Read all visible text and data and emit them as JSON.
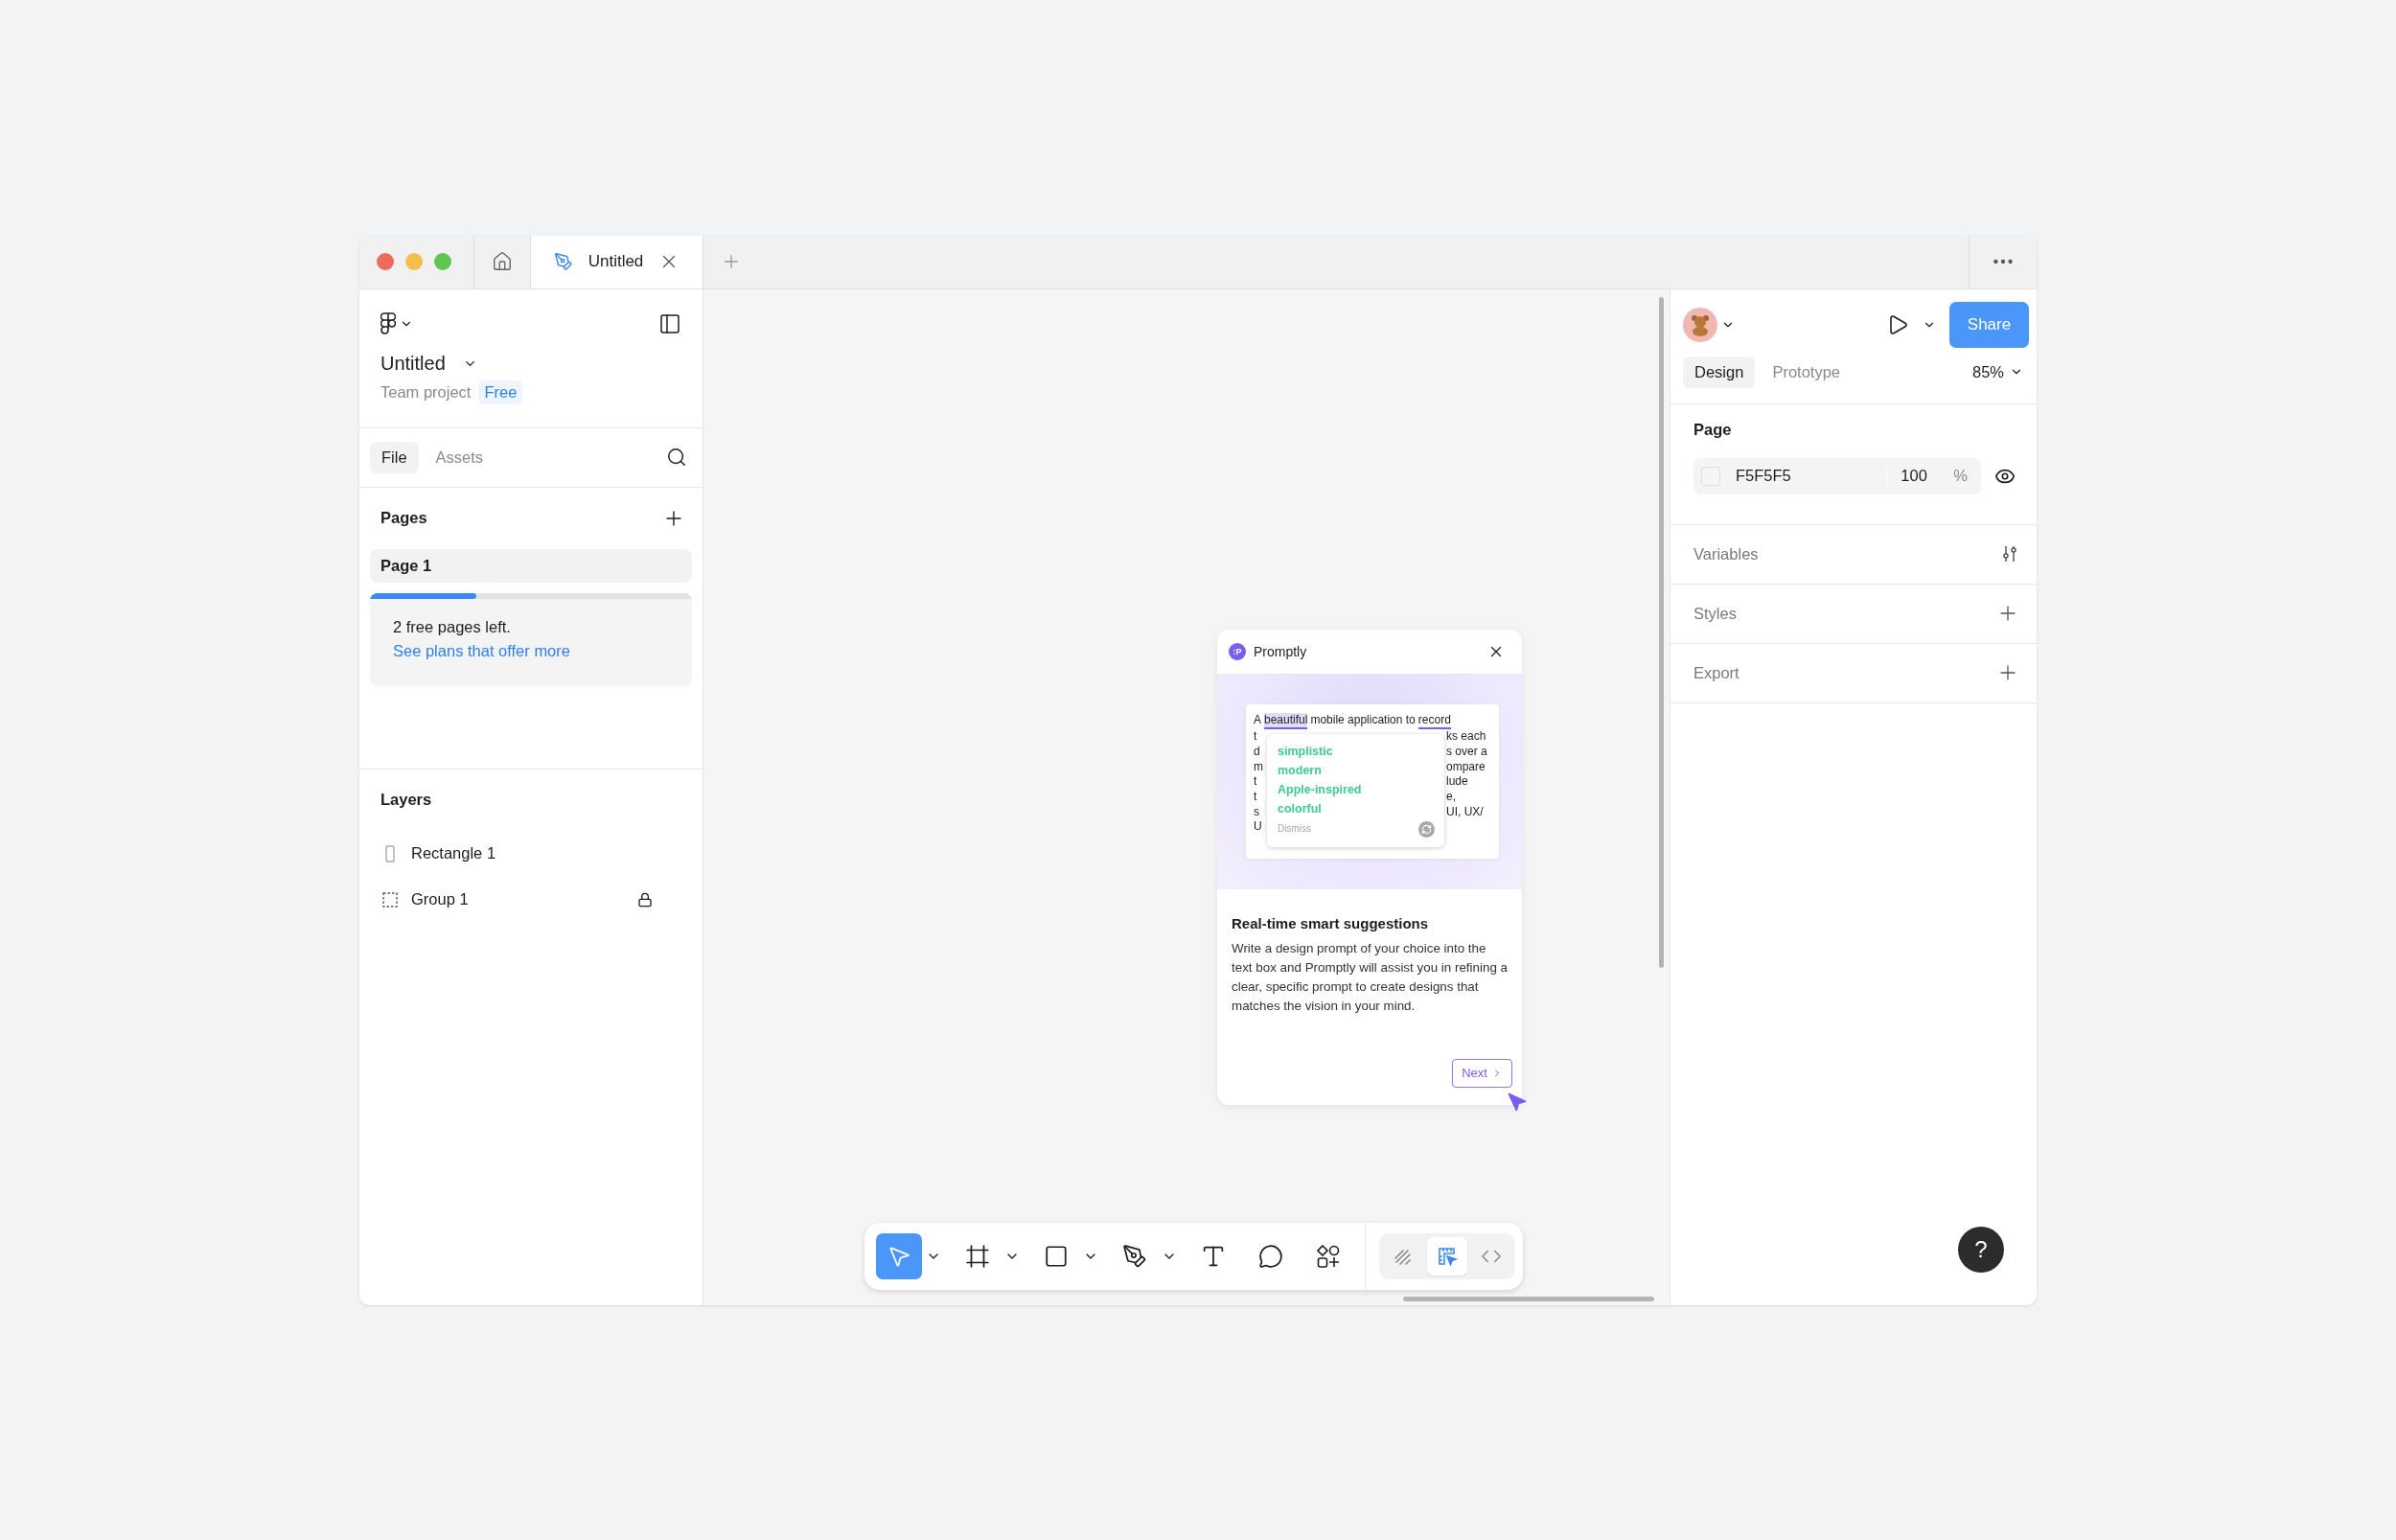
{
  "window": {
    "tabs": [
      {
        "kind": "home",
        "selected": false
      },
      {
        "kind": "file",
        "title": "Untitled",
        "selected": true
      }
    ]
  },
  "left_panel": {
    "file_name": "Untitled",
    "project": "Team project",
    "plan_badge": "Free",
    "tabs": [
      {
        "label": "File",
        "selected": true
      },
      {
        "label": "Assets",
        "selected": false
      }
    ],
    "pages": {
      "title": "Pages",
      "items": [
        {
          "label": "Page 1",
          "selected": true
        }
      ],
      "limit": {
        "level": 0.33,
        "message": "2 free pages left.",
        "link": "See plans that offer more"
      }
    },
    "layers": {
      "title": "Layers",
      "items": [
        {
          "name": "Rectangle 1",
          "kind": "rectangle",
          "locked": false
        },
        {
          "name": "Group 1",
          "kind": "group",
          "locked": true
        }
      ]
    }
  },
  "plugin": {
    "badge": ":P",
    "title": "Promptly",
    "prompt_first_line": [
      {
        "text": "A",
        "kind": "plain"
      },
      {
        "text": "beautiful",
        "kind": "highlight"
      },
      {
        "text": "mobile application to",
        "kind": "plain"
      },
      {
        "text": "record",
        "kind": "underline"
      }
    ],
    "prompt_lines": [
      {
        "left": "t",
        "right": "ks each"
      },
      {
        "left": "d",
        "right": "s over a"
      },
      {
        "left": "m",
        "right": "ompare"
      },
      {
        "left": "t",
        "right": "lude"
      },
      {
        "left": "t",
        "right": "e,"
      },
      {
        "left": "s",
        "right": "UI, UX/"
      },
      {
        "left": "U"
      }
    ],
    "suggestions": [
      "simplistic",
      "modern",
      "Apple-inspired",
      "colorful"
    ],
    "dismiss": "Dismiss",
    "heading": "Real-time smart suggestions",
    "body": "Write a design prompt of your choice into the text box and Promptly will assist you in refining a clear, specific prompt to create designs that matches the vision in your mind.",
    "next": "Next"
  },
  "toolbar": {
    "tools": [
      {
        "selected": true,
        "caret": true
      },
      {
        "selected": false,
        "caret": true
      },
      {
        "selected": false,
        "caret": true
      },
      {
        "selected": false,
        "caret": true
      },
      {
        "selected": false,
        "caret": false
      },
      {
        "selected": false,
        "caret": false
      },
      {
        "selected": false,
        "caret": false
      }
    ],
    "modes": [
      {
        "selected": false
      },
      {
        "selected": true
      },
      {
        "selected": false
      }
    ]
  },
  "right_panel": {
    "share": "Share",
    "tabs": [
      {
        "label": "Design",
        "selected": true
      },
      {
        "label": "Prototype",
        "selected": false
      }
    ],
    "zoom": "85%",
    "page": {
      "title": "Page",
      "color": "F5F5F5",
      "opacity": "100",
      "unit": "%"
    },
    "sections": [
      {
        "title": "Variables",
        "kind": "variables"
      },
      {
        "title": "Styles",
        "kind": "add"
      },
      {
        "title": "Export",
        "kind": "add"
      }
    ]
  },
  "help": "?"
}
